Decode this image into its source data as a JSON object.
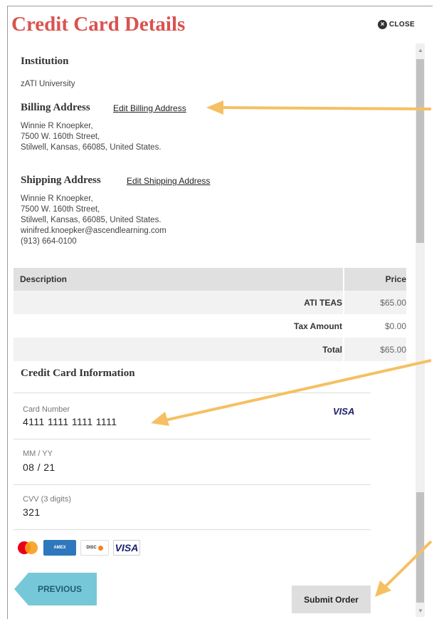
{
  "modal": {
    "title": "Credit Card Details",
    "close_label": "CLOSE"
  },
  "institution": {
    "heading": "Institution",
    "name": "zATI University"
  },
  "billing": {
    "heading": "Billing Address",
    "edit_link": "Edit Billing Address",
    "lines": [
      "Winnie R Knoepker,",
      "7500 W. 160th Street,",
      "Stilwell, Kansas, 66085, United States."
    ]
  },
  "shipping": {
    "heading": "Shipping Address",
    "edit_link": "Edit Shipping Address",
    "lines": [
      "Winnie R Knoepker,",
      "7500 W. 160th Street,",
      "Stilwell, Kansas, 66085, United States.",
      "winifred.knoepker@ascendlearning.com",
      "(913) 664-0100"
    ]
  },
  "order_table": {
    "headers": {
      "description": "Description",
      "price": "Price"
    },
    "rows": [
      {
        "label": "ATI TEAS",
        "price": "$65.00"
      },
      {
        "label": "Tax Amount",
        "price": "$0.00"
      },
      {
        "label": "Total",
        "price": "$65.00"
      }
    ]
  },
  "credit_card": {
    "heading": "Credit Card Information",
    "card_number_label": "Card Number",
    "card_number_value": "4111 1111 1111 1111",
    "card_brand": "VISA",
    "expiry_label": "MM / YY",
    "expiry_value": "08 / 21",
    "cvv_label": "CVV (3 digits)",
    "cvv_value": "321"
  },
  "accepted_cards": [
    "mastercard-icon",
    "amex-icon",
    "discover-icon",
    "visa-icon"
  ],
  "buttons": {
    "previous": "PREVIOUS",
    "submit": "Submit Order"
  },
  "colors": {
    "title": "#d9534f",
    "previous_button": "#76c8d9",
    "annotation_arrow": "#f5c063"
  }
}
